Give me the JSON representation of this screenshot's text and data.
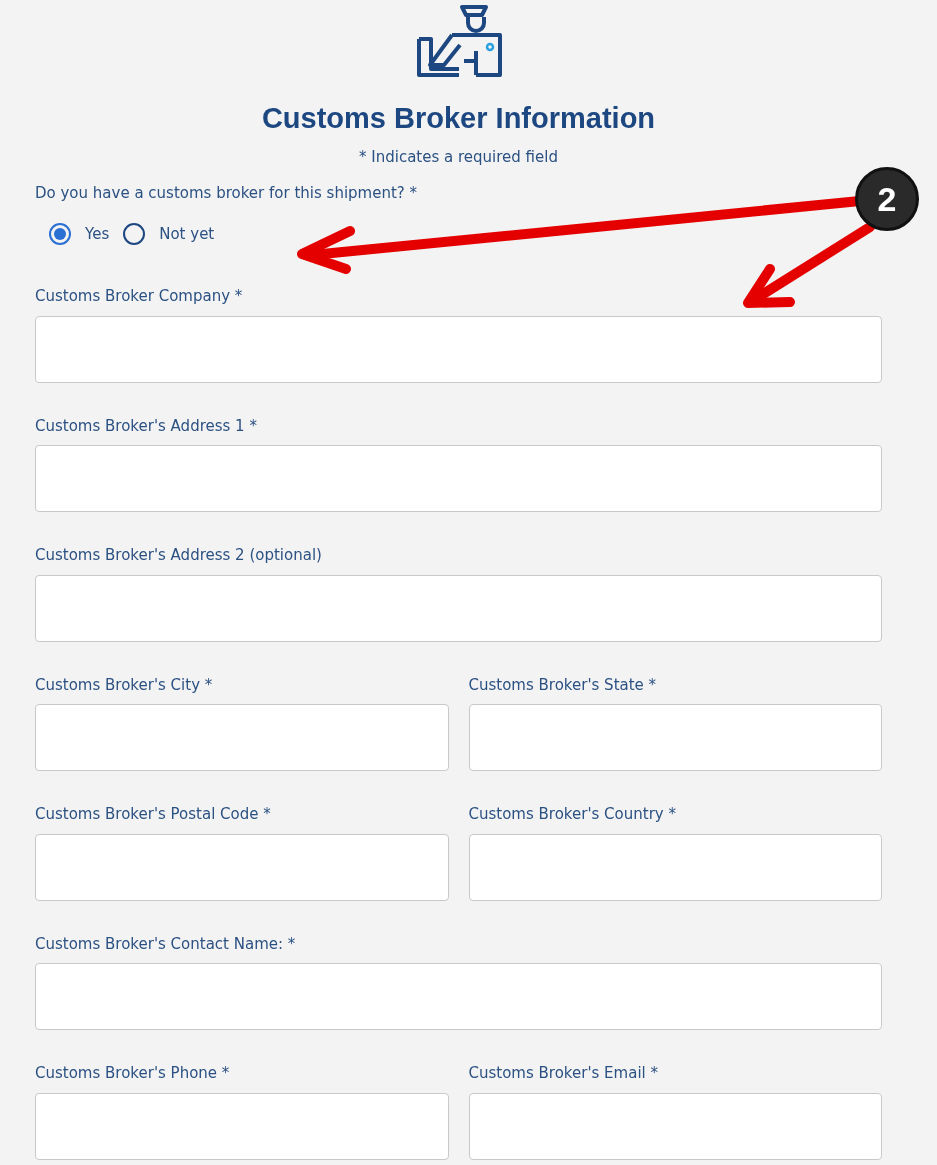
{
  "title": "Customs Broker Information",
  "required_note": "* Indicates a required field",
  "question": {
    "label": "Do you have a customs broker for this shipment? *",
    "options": [
      {
        "label": "Yes",
        "selected": true
      },
      {
        "label": "Not yet",
        "selected": false
      }
    ]
  },
  "rows": [
    {
      "fields": [
        {
          "label": "Customs Broker Company *"
        }
      ]
    },
    {
      "fields": [
        {
          "label": "Customs Broker's Address 1 *"
        }
      ]
    },
    {
      "fields": [
        {
          "label": "Customs Broker's Address 2 (optional)"
        }
      ]
    },
    {
      "fields": [
        {
          "label": "Customs Broker's City *"
        },
        {
          "label": "Customs Broker's State *"
        }
      ]
    },
    {
      "fields": [
        {
          "label": "Customs Broker's Postal Code *"
        },
        {
          "label": "Customs Broker's Country *"
        }
      ]
    },
    {
      "fields": [
        {
          "label": "Customs Broker's Contact Name: *"
        }
      ]
    },
    {
      "fields": [
        {
          "label": "Customs Broker's Phone *"
        },
        {
          "label": "Customs Broker's Email *"
        }
      ]
    }
  ],
  "annotation": {
    "badge": "2"
  }
}
